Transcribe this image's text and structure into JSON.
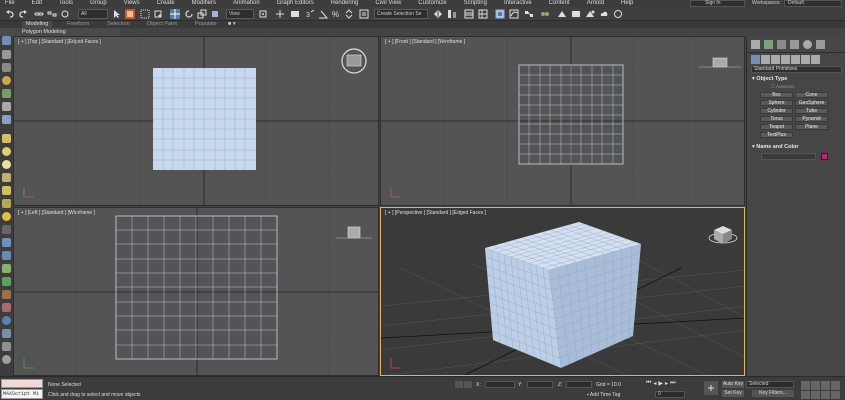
{
  "menu": [
    "File",
    "Edit",
    "Tools",
    "Group",
    "Views",
    "Create",
    "Modifiers",
    "Animation",
    "Graph Editors",
    "Rendering",
    "Civil View",
    "Customize",
    "Scripting",
    "Interactive",
    "Content",
    "Arnold",
    "Help"
  ],
  "signin": "Sign In",
  "workspaces": {
    "label": "Workspaces:",
    "value": "Default"
  },
  "toolbar": {
    "filter": "All",
    "view": "View",
    "selection_set": "Create Selection Se"
  },
  "ribbon": {
    "tabs": [
      "Modeling",
      "Freeform",
      "Selection",
      "Object Paint",
      "Populate"
    ],
    "sub": "Polygon Modeling"
  },
  "viewports": {
    "top": "[ + ] [Top ] [Standard ] [Edged Faces ]",
    "front": "[ + ] [Front ] [Standard ] [Wireframe ]",
    "left": "[ + ] [Left ] [Standard ] [Wireframe ]",
    "persp": "[ + ] [Perspective ] [Standard ] [Edged Faces ]"
  },
  "command_panel": {
    "category": "Standard Primitives",
    "object_type": "Object Type",
    "autogrid": "AutoGrid",
    "buttons": [
      "Box",
      "Cone",
      "Sphere",
      "GeoSphere",
      "Cylinder",
      "Tube",
      "Torus",
      "Pyramid",
      "Teapot",
      "Plane",
      "TextPlus"
    ],
    "name_color": "Name and Color",
    "swatch_color": "#c4236f"
  },
  "status": {
    "maxscript": "MAXScript Mi",
    "selected": "None Selected",
    "prompt": "Click and drag to select and move objects",
    "x_label": "X:",
    "y_label": "Y:",
    "z_label": "Z:",
    "grid": "Grid = 10.0",
    "add_time_tag": "Add Time Tag",
    "frame": "0",
    "auto_key": "Auto Key",
    "set_key": "Set Key",
    "selected_dd": "Selected",
    "key_filters": "Key Filters..."
  },
  "colors": {
    "bg": "#444444",
    "viewport": "#545454",
    "persp_bg": "#3a3a3a",
    "active_border": "#d6b85a",
    "object": "#c8d8ef"
  }
}
